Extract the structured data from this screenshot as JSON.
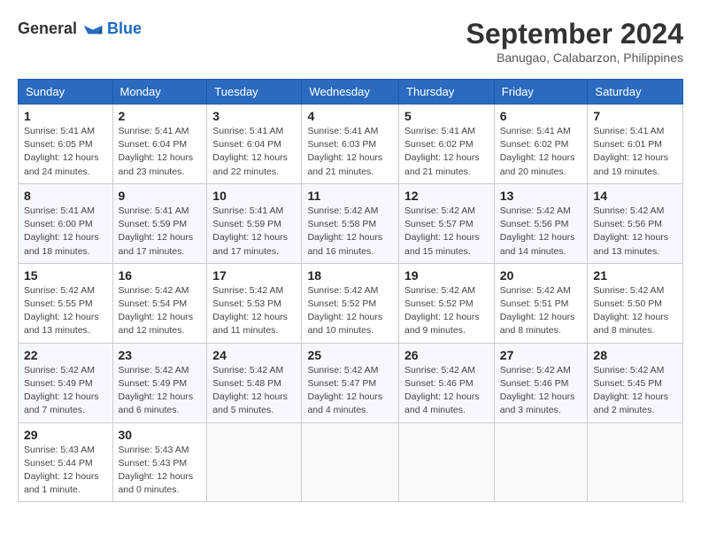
{
  "header": {
    "logo": {
      "text_general": "General",
      "text_blue": "Blue"
    },
    "title": "September 2024",
    "subtitle": "Banugao, Calabarzon, Philippines"
  },
  "calendar": {
    "days_of_week": [
      "Sunday",
      "Monday",
      "Tuesday",
      "Wednesday",
      "Thursday",
      "Friday",
      "Saturday"
    ],
    "weeks": [
      [
        {
          "num": "1",
          "lines": [
            "Sunrise: 5:41 AM",
            "Sunset: 6:05 PM",
            "Daylight: 12 hours",
            "and 24 minutes."
          ]
        },
        {
          "num": "2",
          "lines": [
            "Sunrise: 5:41 AM",
            "Sunset: 6:04 PM",
            "Daylight: 12 hours",
            "and 23 minutes."
          ]
        },
        {
          "num": "3",
          "lines": [
            "Sunrise: 5:41 AM",
            "Sunset: 6:04 PM",
            "Daylight: 12 hours",
            "and 22 minutes."
          ]
        },
        {
          "num": "4",
          "lines": [
            "Sunrise: 5:41 AM",
            "Sunset: 6:03 PM",
            "Daylight: 12 hours",
            "and 21 minutes."
          ]
        },
        {
          "num": "5",
          "lines": [
            "Sunrise: 5:41 AM",
            "Sunset: 6:02 PM",
            "Daylight: 12 hours",
            "and 21 minutes."
          ]
        },
        {
          "num": "6",
          "lines": [
            "Sunrise: 5:41 AM",
            "Sunset: 6:02 PM",
            "Daylight: 12 hours",
            "and 20 minutes."
          ]
        },
        {
          "num": "7",
          "lines": [
            "Sunrise: 5:41 AM",
            "Sunset: 6:01 PM",
            "Daylight: 12 hours",
            "and 19 minutes."
          ]
        }
      ],
      [
        {
          "num": "8",
          "lines": [
            "Sunrise: 5:41 AM",
            "Sunset: 6:00 PM",
            "Daylight: 12 hours",
            "and 18 minutes."
          ]
        },
        {
          "num": "9",
          "lines": [
            "Sunrise: 5:41 AM",
            "Sunset: 5:59 PM",
            "Daylight: 12 hours",
            "and 17 minutes."
          ]
        },
        {
          "num": "10",
          "lines": [
            "Sunrise: 5:41 AM",
            "Sunset: 5:59 PM",
            "Daylight: 12 hours",
            "and 17 minutes."
          ]
        },
        {
          "num": "11",
          "lines": [
            "Sunrise: 5:42 AM",
            "Sunset: 5:58 PM",
            "Daylight: 12 hours",
            "and 16 minutes."
          ]
        },
        {
          "num": "12",
          "lines": [
            "Sunrise: 5:42 AM",
            "Sunset: 5:57 PM",
            "Daylight: 12 hours",
            "and 15 minutes."
          ]
        },
        {
          "num": "13",
          "lines": [
            "Sunrise: 5:42 AM",
            "Sunset: 5:56 PM",
            "Daylight: 12 hours",
            "and 14 minutes."
          ]
        },
        {
          "num": "14",
          "lines": [
            "Sunrise: 5:42 AM",
            "Sunset: 5:56 PM",
            "Daylight: 12 hours",
            "and 13 minutes."
          ]
        }
      ],
      [
        {
          "num": "15",
          "lines": [
            "Sunrise: 5:42 AM",
            "Sunset: 5:55 PM",
            "Daylight: 12 hours",
            "and 13 minutes."
          ]
        },
        {
          "num": "16",
          "lines": [
            "Sunrise: 5:42 AM",
            "Sunset: 5:54 PM",
            "Daylight: 12 hours",
            "and 12 minutes."
          ]
        },
        {
          "num": "17",
          "lines": [
            "Sunrise: 5:42 AM",
            "Sunset: 5:53 PM",
            "Daylight: 12 hours",
            "and 11 minutes."
          ]
        },
        {
          "num": "18",
          "lines": [
            "Sunrise: 5:42 AM",
            "Sunset: 5:52 PM",
            "Daylight: 12 hours",
            "and 10 minutes."
          ]
        },
        {
          "num": "19",
          "lines": [
            "Sunrise: 5:42 AM",
            "Sunset: 5:52 PM",
            "Daylight: 12 hours",
            "and 9 minutes."
          ]
        },
        {
          "num": "20",
          "lines": [
            "Sunrise: 5:42 AM",
            "Sunset: 5:51 PM",
            "Daylight: 12 hours",
            "and 8 minutes."
          ]
        },
        {
          "num": "21",
          "lines": [
            "Sunrise: 5:42 AM",
            "Sunset: 5:50 PM",
            "Daylight: 12 hours",
            "and 8 minutes."
          ]
        }
      ],
      [
        {
          "num": "22",
          "lines": [
            "Sunrise: 5:42 AM",
            "Sunset: 5:49 PM",
            "Daylight: 12 hours",
            "and 7 minutes."
          ]
        },
        {
          "num": "23",
          "lines": [
            "Sunrise: 5:42 AM",
            "Sunset: 5:49 PM",
            "Daylight: 12 hours",
            "and 6 minutes."
          ]
        },
        {
          "num": "24",
          "lines": [
            "Sunrise: 5:42 AM",
            "Sunset: 5:48 PM",
            "Daylight: 12 hours",
            "and 5 minutes."
          ]
        },
        {
          "num": "25",
          "lines": [
            "Sunrise: 5:42 AM",
            "Sunset: 5:47 PM",
            "Daylight: 12 hours",
            "and 4 minutes."
          ]
        },
        {
          "num": "26",
          "lines": [
            "Sunrise: 5:42 AM",
            "Sunset: 5:46 PM",
            "Daylight: 12 hours",
            "and 4 minutes."
          ]
        },
        {
          "num": "27",
          "lines": [
            "Sunrise: 5:42 AM",
            "Sunset: 5:46 PM",
            "Daylight: 12 hours",
            "and 3 minutes."
          ]
        },
        {
          "num": "28",
          "lines": [
            "Sunrise: 5:42 AM",
            "Sunset: 5:45 PM",
            "Daylight: 12 hours",
            "and 2 minutes."
          ]
        }
      ],
      [
        {
          "num": "29",
          "lines": [
            "Sunrise: 5:43 AM",
            "Sunset: 5:44 PM",
            "Daylight: 12 hours",
            "and 1 minute."
          ]
        },
        {
          "num": "30",
          "lines": [
            "Sunrise: 5:43 AM",
            "Sunset: 5:43 PM",
            "Daylight: 12 hours",
            "and 0 minutes."
          ]
        },
        {
          "num": "",
          "lines": []
        },
        {
          "num": "",
          "lines": []
        },
        {
          "num": "",
          "lines": []
        },
        {
          "num": "",
          "lines": []
        },
        {
          "num": "",
          "lines": []
        }
      ]
    ]
  }
}
